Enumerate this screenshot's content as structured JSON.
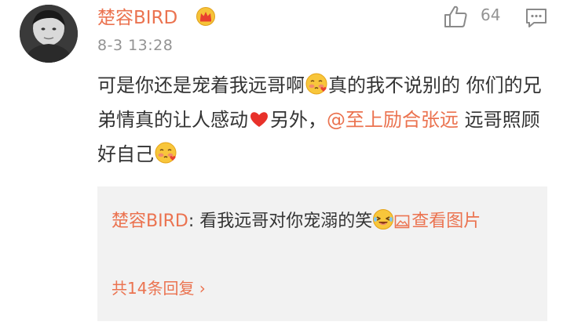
{
  "comment": {
    "username": "楚容BIRD",
    "badge_icon": "crown-icon",
    "timestamp": "8-3 13:28",
    "like_count": "64",
    "like_icon": "thumbs-up-icon",
    "comment_icon": "comment-icon",
    "text_part1": "可是你还是宠着我远哥啊",
    "text_part2": "真的我不说别的 你们的兄弟情真的让人感动",
    "text_part3": "另外，",
    "mention": "@至上励合张远",
    "text_part4": " 远哥照顾好自己",
    "emojis": [
      "blush-kiss-emoji",
      "heart-emoji",
      "blush-kiss-emoji"
    ]
  },
  "reply": {
    "username": "楚容BIRD",
    "separator": ": ",
    "text": "看我远哥对你宠溺的笑",
    "emoji": "laughing-emoji",
    "view_picture": "查看图片",
    "view_picture_icon": "image-icon",
    "count_label": "共14条回复 ›"
  },
  "colors": {
    "accent": "#eb7350",
    "text": "#333333",
    "muted": "#939393",
    "reply_bg": "#f2f2f2"
  }
}
